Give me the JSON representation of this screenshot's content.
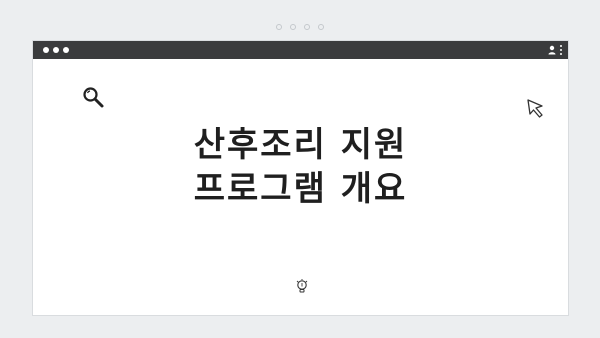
{
  "pager": {
    "count": 4
  },
  "window": {
    "traffic_lights": 3
  },
  "content": {
    "title_line1": "산후조리 지원",
    "title_line2": "프로그램 개요"
  },
  "icons": {
    "top_left": "search-icon",
    "top_right": "cursor-icon",
    "bottom": "lightbulb-icon",
    "titlebar": [
      "user-icon",
      "kebab-menu-icon"
    ]
  },
  "colors": {
    "background": "#eceef0",
    "titlebar": "#3a3b3d",
    "window": "#ffffff",
    "text": "#1f1f1f"
  }
}
